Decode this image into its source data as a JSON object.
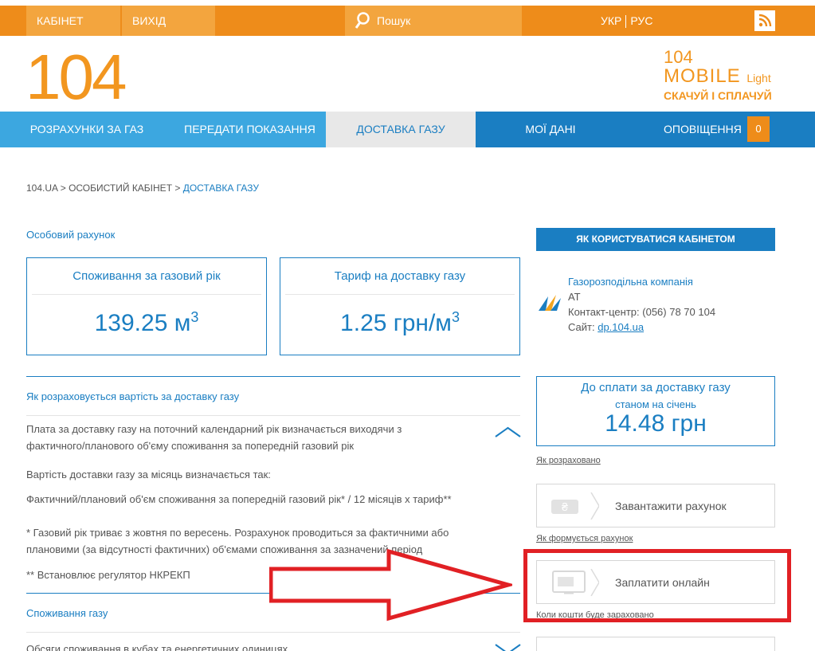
{
  "topbar": {
    "cabinet": "КАБІНЕТ",
    "logout": "ВИХІД",
    "search_placeholder": "Пошук",
    "lang_ua": "УКР",
    "lang_ru": "РУС"
  },
  "header": {
    "logo": "104",
    "mobile_line1": "104",
    "mobile_line2": "MOBILE",
    "mobile_light": "Light",
    "mobile_line3": "СКАЧУЙ І СПЛАЧУЙ"
  },
  "nav": {
    "items": [
      {
        "label": "РОЗРАХУНКИ ЗА ГАЗ"
      },
      {
        "label": "ПЕРЕДАТИ ПОКАЗАННЯ"
      },
      {
        "label": "ДОСТАВКА ГАЗУ"
      },
      {
        "label": "МОЇ ДАНІ"
      },
      {
        "label": "ОПОВІЩЕННЯ"
      }
    ],
    "notifications_count": "0",
    "active": "ДОСТАВКА ГАЗУ"
  },
  "breadcrumb": {
    "home": "104.UA",
    "sep": " > ",
    "cabinet": "ОСОБИСТИЙ КАБІНЕТ",
    "current": "ДОСТАВКА ГАЗУ"
  },
  "main": {
    "account_title": "Особовий рахунок",
    "consumption_title": "Споживання за газовий рік",
    "consumption_value": "139.25 м",
    "consumption_sup": "3",
    "tariff_title": "Тариф на доставку газу",
    "tariff_value": "1.25 грн/м",
    "tariff_sup": "3",
    "how_calc_title": "Як розраховується вартість за доставку газу",
    "para1_l1": "Плата за доставку газу на поточний календарний рік визначається виходячи з",
    "para1_l2": "фактичного/планового об'єму споживання за попередній газовий рік",
    "para2": "Вартість доставки газу за місяць визначається так:",
    "para3": "Фактичний/плановий об'єм споживання за попередній газовий рік* / 12 місяців х тариф**",
    "para4_l1": "* Газовий рік триває з жовтня по вересень. Розрахунок проводиться за фактичними або",
    "para4_l2": "плановими (за відсутності фактичних) об'ємами споживання за зазначений період",
    "para5": "** Встановлює регулятор НКРЕКП",
    "consumption_section": "Споживання газу",
    "volumes_line": "Обсяги споживання в кубах та енергетичних одиницях"
  },
  "sidebar": {
    "howto": "ЯК КОРИСТУВАТИСЯ КАБІНЕТОМ",
    "company_name": "Газорозподільна компанія",
    "company_type": "АТ",
    "contact": "Контакт-центр: (056) 78 70 104",
    "site_label": "Сайт: ",
    "site_link": "dp.104.ua",
    "pay_title": "До сплати за доставку газу",
    "pay_sub": "станом на січень",
    "pay_amount": "14.48 грн",
    "how_calculated": "Як розраховано",
    "download_bill": "Завантажити рахунок",
    "how_formed": "Як формується рахунок",
    "pay_online": "Заплатити онлайн",
    "when_credited": "Коли кошти буде зараховано"
  },
  "colors": {
    "orange": "#ee8c1a",
    "blue": "#1a7ec2",
    "light_blue": "#3ca7e0",
    "annotation_red": "#e12024"
  },
  "icons": [
    "search-icon",
    "rss-icon",
    "company-logo-icon",
    "chevron-up-icon",
    "chevron-down-icon",
    "download-bill-icon",
    "pay-online-icon"
  ]
}
